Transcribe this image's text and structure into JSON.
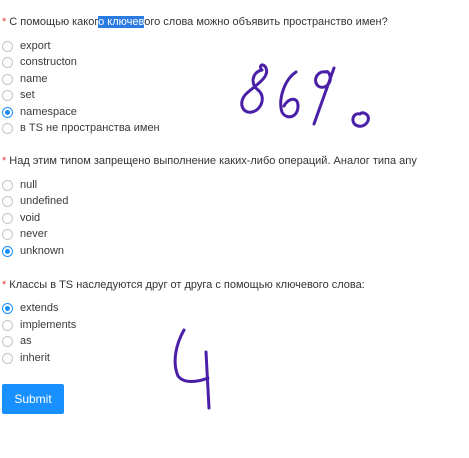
{
  "questions": [
    {
      "title_before": "С помощью каког",
      "title_highlight": "о ключев",
      "title_after": "ого слова можно объявить пространство имен?",
      "options": [
        {
          "label": "export",
          "checked": false
        },
        {
          "label": "constructon",
          "checked": false
        },
        {
          "label": "name",
          "checked": false
        },
        {
          "label": "set",
          "checked": false
        },
        {
          "label": "namespace",
          "checked": true
        },
        {
          "label": "в TS не пространства имен",
          "checked": false
        }
      ]
    },
    {
      "title": "Над этим типом запрещено выполнение каких-либо операций. Аналог типа any",
      "options": [
        {
          "label": "null",
          "checked": false
        },
        {
          "label": "undefined",
          "checked": false
        },
        {
          "label": "void",
          "checked": false
        },
        {
          "label": "never",
          "checked": false
        },
        {
          "label": "unknown",
          "checked": true
        }
      ]
    },
    {
      "title": "Классы в TS наследуются друг от друга с помощью ключевого слова:",
      "options": [
        {
          "label": "extends",
          "checked": true
        },
        {
          "label": "implements",
          "checked": false
        },
        {
          "label": "as",
          "checked": false
        },
        {
          "label": "inherit",
          "checked": false
        }
      ]
    }
  ],
  "required_mark": "*",
  "submit_label": "Submit",
  "colors": {
    "accent": "#1890ff",
    "required": "#e8413d",
    "selection": "#2a7ae2",
    "ink": "#4a1fa8"
  },
  "handwriting": {
    "note_1": "86%",
    "note_2": "4"
  }
}
